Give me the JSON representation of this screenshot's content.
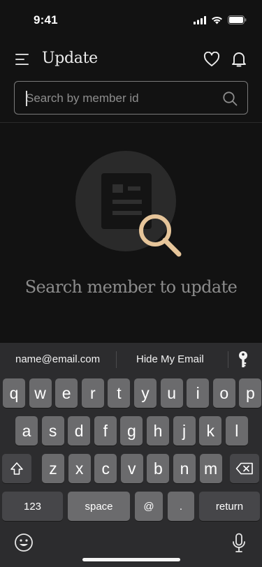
{
  "status": {
    "time": "9:41"
  },
  "header": {
    "title": "Update"
  },
  "search": {
    "placeholder": "Search by member id"
  },
  "empty_state": {
    "message": "Search member to update"
  },
  "keyboard": {
    "suggestions": {
      "email": "name@email.com",
      "hide_email": "Hide My Email"
    },
    "row1": [
      "q",
      "w",
      "e",
      "r",
      "t",
      "y",
      "u",
      "i",
      "o",
      "p"
    ],
    "row2": [
      "a",
      "s",
      "d",
      "f",
      "g",
      "h",
      "j",
      "k",
      "l"
    ],
    "row3": [
      "z",
      "x",
      "c",
      "v",
      "b",
      "n",
      "m"
    ],
    "numbers_label": "123",
    "space_label": "space",
    "at_label": "@",
    "dot_label": ".",
    "return_label": "return"
  },
  "colors": {
    "accent": "#E6C59A",
    "background": "#121212",
    "keyboard": "#2C2C2E"
  }
}
